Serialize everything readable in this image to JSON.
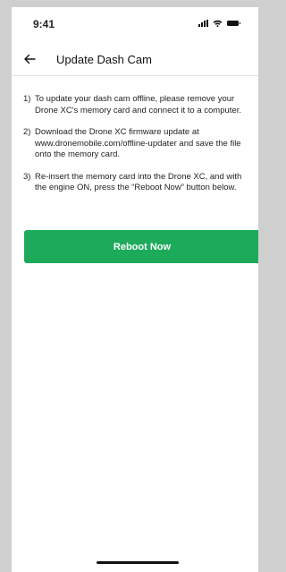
{
  "status_bar": {
    "time": "9:41",
    "icons": [
      "signal-icon",
      "wifi-icon",
      "battery-icon"
    ]
  },
  "header": {
    "back_icon": "arrow-left-icon",
    "title": "Update Dash Cam"
  },
  "instructions": [
    {
      "number": "1)",
      "text": "To update your dash cam offline, please remove your Drone XC's memory card and connect it to a computer."
    },
    {
      "number": "2)",
      "text": "Download the Drone XC firmware update at www.dronemobile.com/offline-updater and save the file onto the memory card."
    },
    {
      "number": "3)",
      "text": "Re-insert the memory card into the Drone XC, and with the engine ON, press the “Reboot Now” button below."
    }
  ],
  "actions": {
    "reboot_label": "Reboot Now"
  },
  "colors": {
    "accent": "#1daa5b",
    "background": "#ffffff",
    "frame": "#cfcfcf"
  }
}
